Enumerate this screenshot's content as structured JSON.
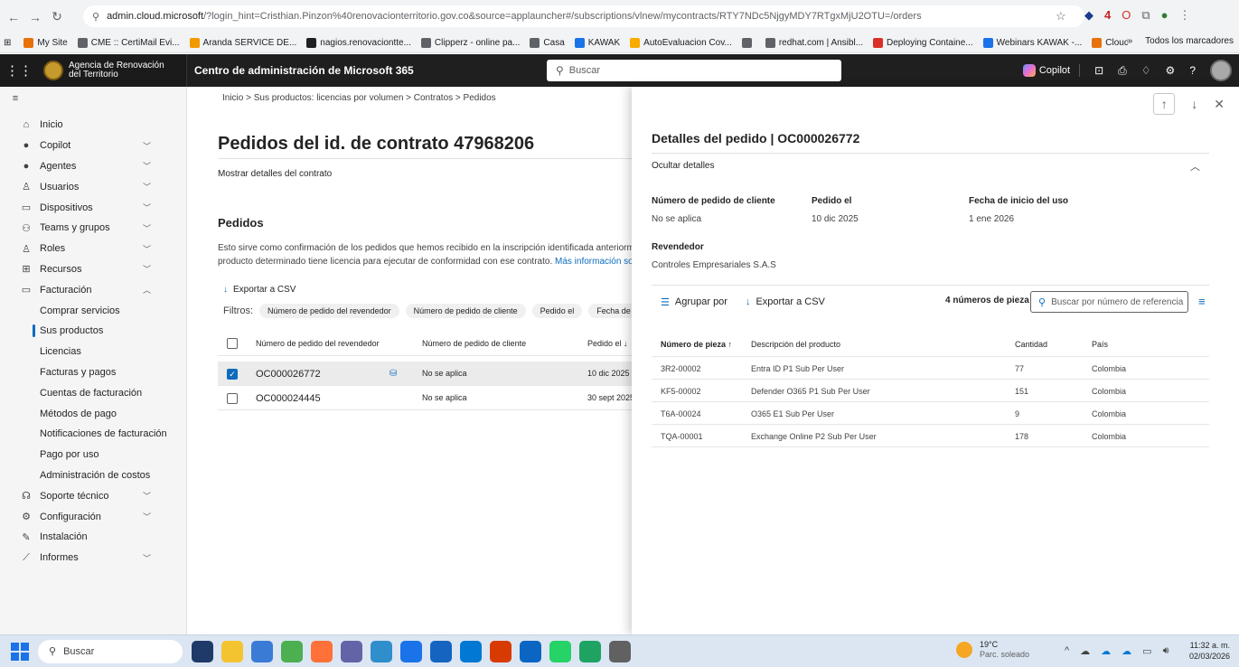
{
  "browser": {
    "url_domain": "admin.cloud.microsoft",
    "url_rest": "/?login_hint=Cristhian.Pinzon%40renovacionterritorio.gov.co&source=applauncher#/subscriptions/vlnew/mycontracts/RTY7NDc5NjgyMDY7RTgxMjU2OTU=/orders",
    "badge_count": "4",
    "bookmarks": [
      {
        "label": "My Site",
        "color": "#e8710a"
      },
      {
        "label": "CME :: CertiMail Evi...",
        "color": "#5f6368"
      },
      {
        "label": "Aranda SERVICE DE...",
        "color": "#f29900"
      },
      {
        "label": "nagios.renovaciontte...",
        "color": "#202124"
      },
      {
        "label": "Clipperz - online pa...",
        "color": "#5f6368"
      },
      {
        "label": "Casa",
        "color": "#5f6368"
      },
      {
        "label": "KAWAK",
        "color": "#1a73e8"
      },
      {
        "label": "AutoEvaluacion Cov...",
        "color": "#f9ab00"
      },
      {
        "label": "",
        "color": "#5f6368"
      },
      {
        "label": "redhat.com | Ansibl...",
        "color": "#5f6368"
      },
      {
        "label": "Deploying Containe...",
        "color": "#d93025"
      },
      {
        "label": "Webinars KAWAK -...",
        "color": "#1a73e8"
      },
      {
        "label": "Cloud Cost Estimator",
        "color": "#e8710a"
      }
    ],
    "bookmarks_more": "»",
    "bookmarks_all": "Todos los marcadores"
  },
  "m365": {
    "org_name_line1": "Agencia de Renovación",
    "org_name_line2": "del Territorio",
    "app_title": "Centro de administración de Microsoft 365",
    "search_placeholder": "Buscar",
    "copilot_label": "Copilot"
  },
  "sidebar": {
    "items": [
      {
        "label": "Inicio",
        "icon": "home-icon",
        "glyph": "⌂",
        "chev": false
      },
      {
        "label": "Copilot",
        "icon": "copilot-icon",
        "glyph": "●",
        "chev": true
      },
      {
        "label": "Agentes",
        "icon": "agents-icon",
        "glyph": "●",
        "chev": true
      },
      {
        "label": "Usuarios",
        "icon": "user-icon",
        "glyph": "♙",
        "chev": true
      },
      {
        "label": "Dispositivos",
        "icon": "devices-icon",
        "glyph": "▭",
        "chev": true
      },
      {
        "label": "Teams y grupos",
        "icon": "teams-icon",
        "glyph": "⚇",
        "chev": true
      },
      {
        "label": "Roles",
        "icon": "roles-icon",
        "glyph": "♙",
        "chev": true
      },
      {
        "label": "Recursos",
        "icon": "resources-icon",
        "glyph": "⊞",
        "chev": true
      },
      {
        "label": "Facturación",
        "icon": "billing-icon",
        "glyph": "▭",
        "chev": true,
        "expanded": true
      }
    ],
    "sub_items": [
      {
        "label": "Comprar servicios",
        "active": false
      },
      {
        "label": "Sus productos",
        "active": true
      },
      {
        "label": "Licencias",
        "active": false
      },
      {
        "label": "Facturas y pagos",
        "active": false
      },
      {
        "label": "Cuentas de facturación",
        "active": false
      },
      {
        "label": "Métodos de pago",
        "active": false
      },
      {
        "label": "Notificaciones de facturación",
        "active": false
      },
      {
        "label": "Pago por uso",
        "active": false
      },
      {
        "label": "Administración de costos",
        "active": false
      }
    ],
    "bottom_items": [
      {
        "label": "Soporte técnico",
        "icon": "support-icon",
        "glyph": "☊",
        "chev": true
      },
      {
        "label": "Configuración",
        "icon": "settings-icon",
        "glyph": "⚙",
        "chev": true
      },
      {
        "label": "Instalación",
        "icon": "setup-icon",
        "glyph": "✎",
        "chev": false
      },
      {
        "label": "Informes",
        "icon": "reports-icon",
        "glyph": "⟋",
        "chev": true
      }
    ]
  },
  "main": {
    "breadcrumb": "Inicio  >  Sus productos: licencias por volumen  >  Contratos  >  Pedidos",
    "title": "Pedidos del id. de contrato 47968206",
    "show_details": "Mostrar detalles del contrato",
    "section_title": "Pedidos",
    "desc_line1": "Esto sirve como confirmación de los pedidos que hemos recibido en la inscripción identificada anteriorme",
    "desc_line2": "producto determinado tiene licencia para ejecutar de conformidad con ese contrato.",
    "desc_link": "Más información sob",
    "export": "Exportar a CSV",
    "filters_label": "Filtros:",
    "filters": [
      "Número de pedido del revendedor",
      "Número de pedido de cliente",
      "Pedido el",
      "Fecha de inicio"
    ],
    "columns": [
      "Número de pedido del revendedor",
      "Número de pedido de cliente",
      "Pedido el ↓"
    ],
    "rows": [
      {
        "reseller_order": "OC000026772",
        "customer_order": "No se aplica",
        "date": "10 dic 2025",
        "selected": true
      },
      {
        "reseller_order": "OC000024445",
        "customer_order": "No se aplica",
        "date": "30 sept 2025",
        "selected": false
      }
    ]
  },
  "panel": {
    "title": "Detalles del pedido | OC000026772",
    "hide_details": "Ocultar detalles",
    "fields": {
      "customer_order_label": "Número de pedido de cliente",
      "customer_order_value": "No se aplica",
      "ordered_label": "Pedido el",
      "ordered_value": "10 dic 2025",
      "start_label": "Fecha de inicio del uso",
      "start_value": "1 ene 2026",
      "reseller_label": "Revendedor",
      "reseller_value": "Controles Empresariales S.A.S"
    },
    "group_by": "Agrupar por",
    "export": "Exportar a CSV",
    "count": "4 números de pieza",
    "search_placeholder": "Buscar por número de referencia",
    "columns": {
      "part": "Número de pieza ↑",
      "desc": "Descripción del producto",
      "qty": "Cantidad",
      "country": "País"
    },
    "rows": [
      {
        "part": "3R2-00002",
        "desc": "Entra ID P1 Sub Per User",
        "qty": "77",
        "country": "Colombia"
      },
      {
        "part": "KF5-00002",
        "desc": "Defender O365 P1 Sub Per User",
        "qty": "151",
        "country": "Colombia"
      },
      {
        "part": "T6A-00024",
        "desc": "O365 E1 Sub Per User",
        "qty": "9",
        "country": "Colombia"
      },
      {
        "part": "TQA-00001",
        "desc": "Exchange Online P2 Sub Per User",
        "qty": "178",
        "country": "Colombia"
      }
    ]
  },
  "taskbar": {
    "search_label": "Buscar",
    "app_colors": [
      "#1f3a68",
      "#f4c430",
      "#3a7bd5",
      "#4caf50",
      "#ff7139",
      "#6264a7",
      "#2f8ecb",
      "#1a73e8",
      "#1565c0",
      "#0078d4",
      "#d83b01",
      "#0a66c2",
      "#25d366",
      "#1ea362",
      "#616161"
    ],
    "weather_temp": "19°C",
    "weather_desc": "Parc. soleado",
    "time": "11:32 a. m.",
    "date": "02/03/2026"
  }
}
